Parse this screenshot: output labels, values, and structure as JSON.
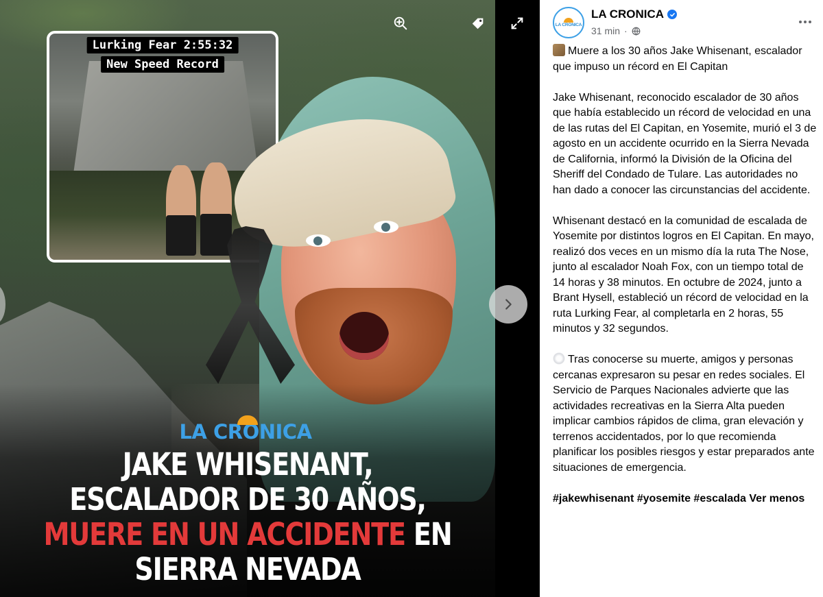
{
  "media": {
    "inset": {
      "line1": "Lurking Fear 2:55:32",
      "line2": "New Speed Record"
    },
    "brand_logo": "LA CRONICA",
    "headline": {
      "line1": "JAKE WHISENANT,",
      "line2": "ESCALADOR DE 30 AÑOS,",
      "line3_red": "MUERE EN UN ACCIDENTE",
      "line3_white": " EN",
      "line4": "SIERRA NEVADA"
    },
    "icons": [
      "zoom-in-icon",
      "tag-icon",
      "fullscreen-icon",
      "chevron-right-icon"
    ]
  },
  "post": {
    "page_name": "LA CRONICA",
    "time": "31 min",
    "paragraphs": [
      "Muere a los 30 años Jake Whisenant, escalador que impuso un récord en El Capitan",
      "Jake Whisenant, reconocido escalador de 30 años que había establecido un récord de velocidad en una de las rutas del El Capitan, en Yosemite, murió el 3 de agosto en un accidente ocurrido en la Sierra Nevada de California, informó la División de la Oficina del Sheriff del Condado de Tulare. Las autoridades no han dado a conocer las circunstancias del accidente.",
      "Whisenant destacó en la comunidad de escalada de Yosemite por distintos logros en El Capitan. En mayo, realizó dos veces en un mismo día la ruta The Nose, junto al escalador Noah Fox, con un tiempo total de 14 horas y 38 minutos. En octubre de 2024, junto a Brant Hysell, estableció un récord de velocidad en la ruta Lurking Fear, al completarla en 2 horas, 55 minutos y 32 segundos.",
      "Tras conocerse su muerte, amigos y personas cercanas expresaron su pesar en redes sociales. El Servicio de Parques Nacionales advierte que las actividades recreativas en la Sierra Alta pueden implicar cambios rápidos de clima, gran elevación y terrenos accidentados, por lo que recomienda planificar los posibles riesgos y estar preparados ante situaciones de emergencia."
    ],
    "hashtags": "#jakewhisenant #yosemite #escalada",
    "see_more": "Ver menos",
    "avatar_text": "LA CRONICA"
  },
  "colors": {
    "brand_blue": "#3da0e6",
    "brand_orange": "#f2a11c",
    "headline_red": "#e33a3a",
    "verified_blue": "#1877f2",
    "meta_gray": "#65676b"
  }
}
